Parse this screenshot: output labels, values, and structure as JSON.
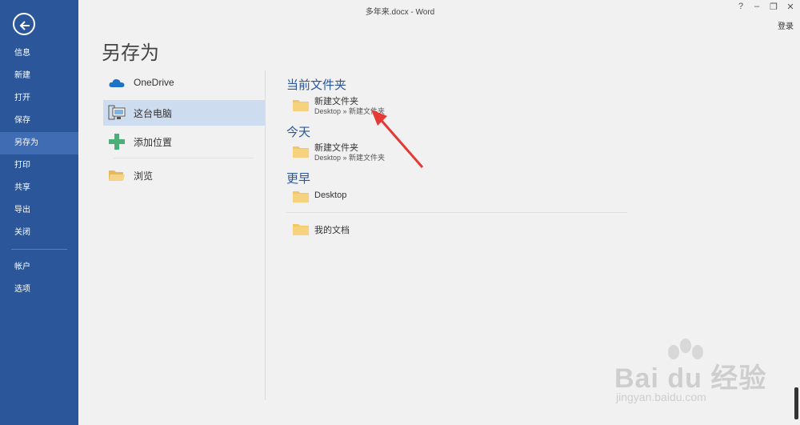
{
  "window": {
    "title": "多年来.docx - Word",
    "help": "?",
    "minimize": "–",
    "restore": "❐",
    "close": "✕",
    "signin": "登录"
  },
  "nav": {
    "items": [
      {
        "label": "信息"
      },
      {
        "label": "新建"
      },
      {
        "label": "打开"
      },
      {
        "label": "保存"
      },
      {
        "label": "另存为"
      },
      {
        "label": "打印"
      },
      {
        "label": "共享"
      },
      {
        "label": "导出"
      },
      {
        "label": "关闭"
      },
      {
        "label": "帐户"
      },
      {
        "label": "选项"
      }
    ],
    "active": "另存为"
  },
  "page": {
    "title": "另存为"
  },
  "locations": [
    {
      "label": "OneDrive",
      "icon": "cloud-icon"
    },
    {
      "label": "这台电脑",
      "icon": "computer-icon"
    },
    {
      "label": "添加位置",
      "icon": "plus-icon"
    },
    {
      "label": "浏览",
      "icon": "open-folder-icon"
    }
  ],
  "sections": {
    "current": {
      "heading": "当前文件夹",
      "folders": [
        {
          "name": "新建文件夹",
          "path": "Desktop » 新建文件夹"
        }
      ]
    },
    "today": {
      "heading": "今天",
      "folders": [
        {
          "name": "新建文件夹",
          "path": "Desktop » 新建文件夹"
        }
      ]
    },
    "older": {
      "heading": "更早",
      "folders": [
        {
          "name": "Desktop"
        },
        {
          "name": "我的文档"
        }
      ]
    }
  },
  "watermark": {
    "logo": "Bai du 经验",
    "url": "jingyan.baidu.com"
  },
  "colors": {
    "nav_bg": "#2b579a",
    "accent": "#2b579a",
    "selected": "#cddcef",
    "folder": "#f3c766"
  }
}
